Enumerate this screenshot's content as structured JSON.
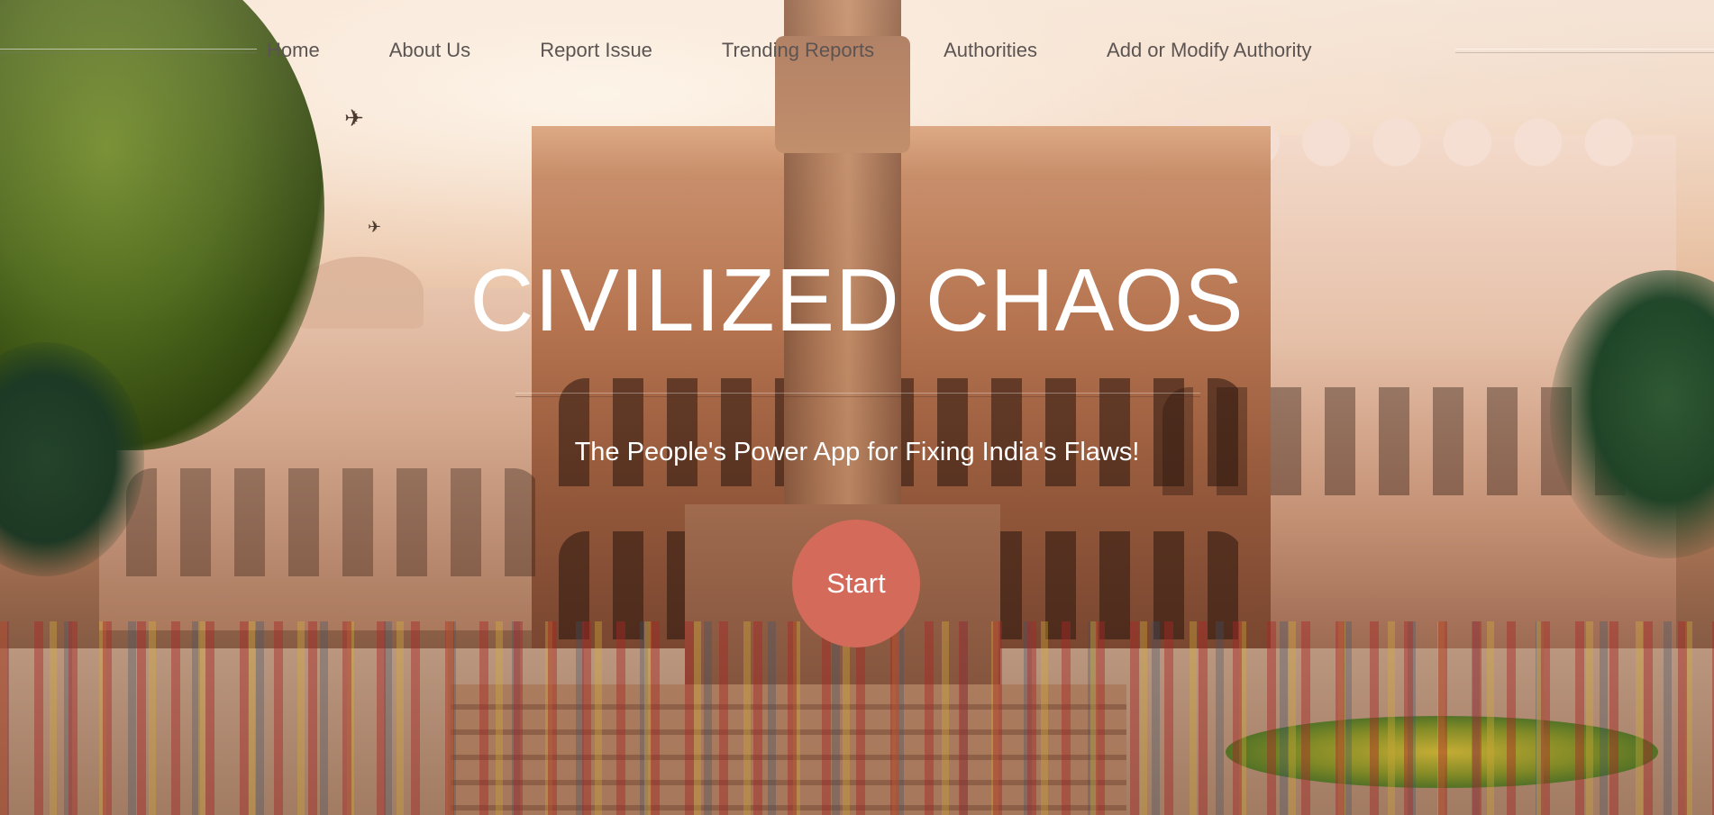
{
  "nav": {
    "items": [
      {
        "label": "Home"
      },
      {
        "label": "About Us"
      },
      {
        "label": "Report Issue"
      },
      {
        "label": "Trending Reports"
      },
      {
        "label": "Authorities"
      },
      {
        "label": "Add or Modify Authority"
      }
    ]
  },
  "hero": {
    "title": "CIVILIZED CHAOS",
    "subtitle": "The People's Power App for Fixing India's Flaws!",
    "start_label": "Start",
    "background_description_icon": "indian-palace-square-photo"
  },
  "colors": {
    "nav_text": "#5c5452",
    "title_text": "#ffffff",
    "button_bg": "#d46a5a",
    "button_text": "#ffffff"
  }
}
